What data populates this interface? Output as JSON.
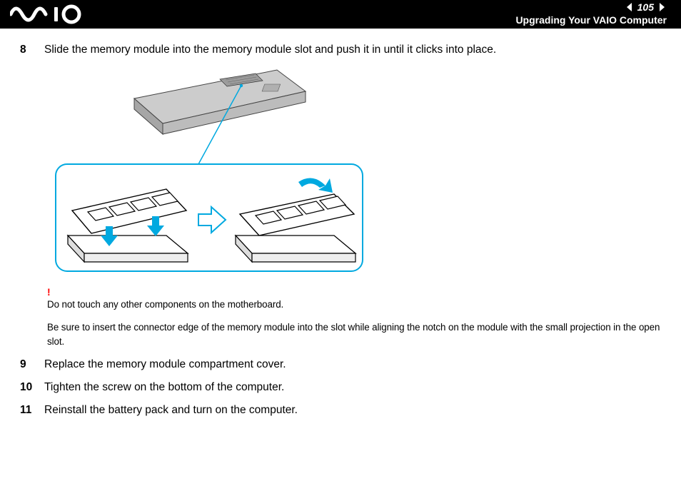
{
  "header": {
    "page_number": "105",
    "section_title": "Upgrading Your VAIO Computer"
  },
  "steps": [
    {
      "num": "8",
      "text": "Slide the memory module into the memory module slot and push it in until it clicks into place."
    },
    {
      "num": "9",
      "text": "Replace the memory module compartment cover."
    },
    {
      "num": "10",
      "text": "Tighten the screw on the bottom of the computer."
    },
    {
      "num": "11",
      "text": "Reinstall the battery pack and turn on the computer."
    }
  ],
  "warning": {
    "bang": "!",
    "text": "Do not touch any other components on the motherboard."
  },
  "note": "Be sure to insert the connector edge of the memory module into the slot while aligning the notch on the module with the small projection in the open slot."
}
